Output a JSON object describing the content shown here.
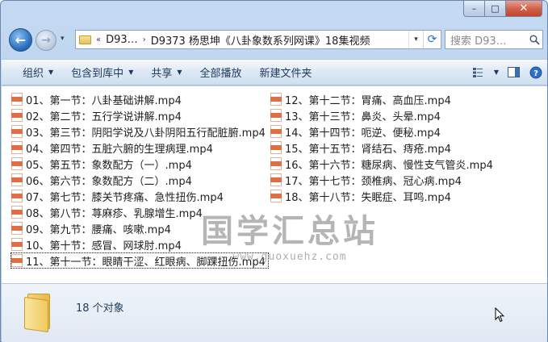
{
  "window": {
    "controls": {
      "minimize": "–",
      "maximize": "□",
      "close": "✕"
    }
  },
  "navigation": {
    "back_icon": "back-arrow-icon",
    "forward_icon": "forward-arrow-icon",
    "recent_dropdown": "▾"
  },
  "address_bar": {
    "overflow": "«",
    "crumbs": [
      "D93…",
      "D9373 杨思坤《八卦象数系列网课》18集视频"
    ],
    "separator": "›",
    "dropdown": "▾",
    "refresh": "⟳"
  },
  "search": {
    "placeholder": "搜索 D93…"
  },
  "toolbar": {
    "organize": "组织",
    "include_library": "包含到库中",
    "share": "共享",
    "play_all": "全部播放",
    "new_folder": "新建文件夹",
    "dropdown_arrow": "▼"
  },
  "files": {
    "column1": [
      "01、第一节：八卦基础讲解.mp4",
      "02、第二节：五行学说讲解.mp4",
      "03、第三节：阴阳学说及八卦阴阳五行配脏腑.mp4",
      "04、第四节：五脏六腑的生理病理.mp4",
      "05、第五节：象数配方（一）.mp4",
      "06、第六节：象数配方（二）.mp4",
      "07、第七节：膝关节疼痛、急性扭伤.mp4",
      "08、第八节：荨麻疹、乳腺增生.mp4",
      "09、第九节：腰痛、咳嗽.mp4",
      "10、第十节：感冒、网球肘.mp4",
      "11、第十一节：眼睛干涩、红眼病、脚踝扭伤.mp4"
    ],
    "column2": [
      "12、第十二节：胃痛、高血压.mp4",
      "13、第十三节：鼻炎、头晕.mp4",
      "14、第十四节：呃逆、便秘.mp4",
      "15、第十五节：肾结石、痔疮.mp4",
      "16、第十六节：糖尿病、慢性支气管炎.mp4",
      "17、第十七节：颈椎病、冠心病.mp4",
      "18、第十八节：失眠症、耳鸣.mp4"
    ]
  },
  "watermark": {
    "title": "国学汇总站",
    "url": "www.guoxuehz.com"
  },
  "details": {
    "count": "18 个对象"
  },
  "colors": {
    "toolbar_text": "#1e395b",
    "mp4_band": "#e16d43",
    "accent": "#2d73c4"
  }
}
